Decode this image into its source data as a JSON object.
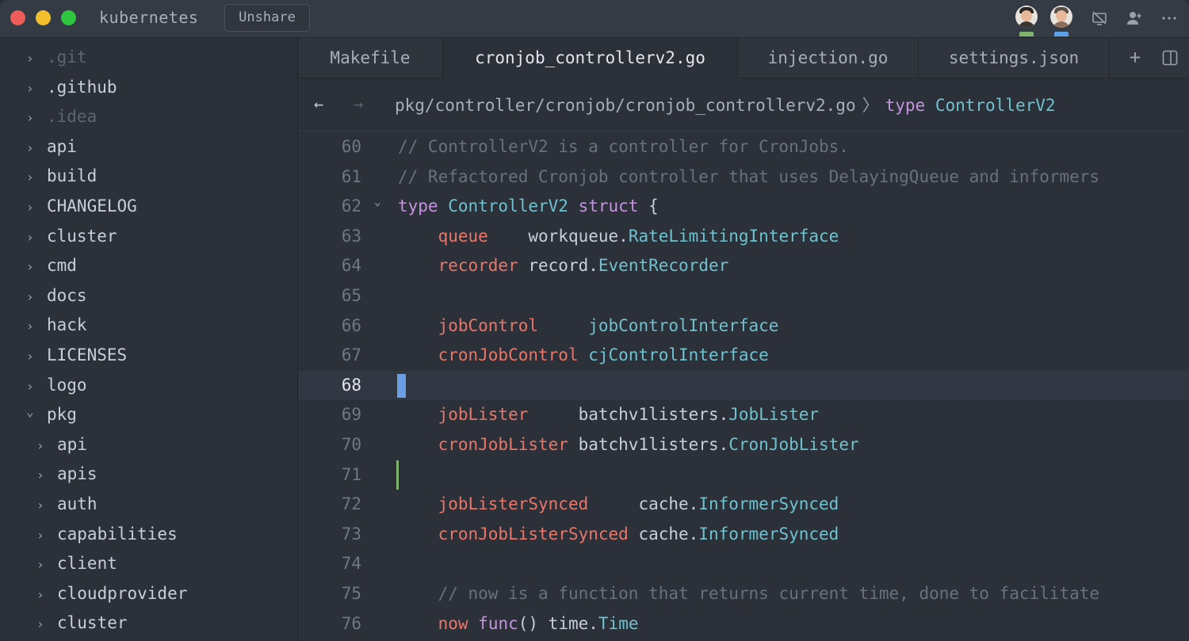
{
  "titlebar": {
    "project": "kubernetes",
    "unshare_label": "Unshare"
  },
  "sidebar": {
    "items": [
      {
        "label": ".git",
        "dim": true,
        "expanded": false
      },
      {
        "label": ".github",
        "dim": false,
        "expanded": false
      },
      {
        "label": ".idea",
        "dim": true,
        "expanded": false
      },
      {
        "label": "api",
        "dim": false,
        "expanded": false
      },
      {
        "label": "build",
        "dim": false,
        "expanded": false
      },
      {
        "label": "CHANGELOG",
        "dim": false,
        "expanded": false
      },
      {
        "label": "cluster",
        "dim": false,
        "expanded": false
      },
      {
        "label": "cmd",
        "dim": false,
        "expanded": false
      },
      {
        "label": "docs",
        "dim": false,
        "expanded": false
      },
      {
        "label": "hack",
        "dim": false,
        "expanded": false
      },
      {
        "label": "LICENSES",
        "dim": false,
        "expanded": false
      },
      {
        "label": "logo",
        "dim": false,
        "expanded": false
      },
      {
        "label": "pkg",
        "dim": false,
        "expanded": true
      },
      {
        "label": "api",
        "dim": false,
        "expanded": false,
        "child": true
      },
      {
        "label": "apis",
        "dim": false,
        "expanded": false,
        "child": true
      },
      {
        "label": "auth",
        "dim": false,
        "expanded": false,
        "child": true
      },
      {
        "label": "capabilities",
        "dim": false,
        "expanded": false,
        "child": true
      },
      {
        "label": "client",
        "dim": false,
        "expanded": false,
        "child": true
      },
      {
        "label": "cloudprovider",
        "dim": false,
        "expanded": false,
        "child": true
      },
      {
        "label": "cluster",
        "dim": false,
        "expanded": false,
        "child": true
      }
    ]
  },
  "tabs": [
    {
      "label": "Makefile",
      "active": false
    },
    {
      "label": "cronjob_controllerv2.go",
      "active": true
    },
    {
      "label": "injection.go",
      "active": false
    },
    {
      "label": "settings.json",
      "active": false
    }
  ],
  "breadcrumb": {
    "path": "pkg/controller/cronjob/cronjob_controllerv2.go",
    "separator": "〉",
    "symbol_kind": "type",
    "symbol_name": "ControllerV2"
  },
  "editor": {
    "current_line": 68,
    "lines": [
      {
        "n": "60",
        "tokens": [
          {
            "t": "// ControllerV2 is a controller for CronJobs.",
            "c": "comment"
          }
        ]
      },
      {
        "n": "61",
        "tokens": [
          {
            "t": "// Refactored Cronjob controller that uses DelayingQueue and informers",
            "c": "comment"
          }
        ]
      },
      {
        "n": "62",
        "fold": true,
        "tokens": [
          {
            "t": "type ",
            "c": "kw"
          },
          {
            "t": "ControllerV2 ",
            "c": "type"
          },
          {
            "t": "struct",
            "c": "kw"
          },
          {
            "t": " {",
            "c": "plain"
          }
        ]
      },
      {
        "n": "63",
        "tokens": [
          {
            "t": "    ",
            "c": "plain"
          },
          {
            "t": "queue",
            "c": "field"
          },
          {
            "t": "    workqueue.",
            "c": "plain"
          },
          {
            "t": "RateLimitingInterface",
            "c": "type"
          }
        ]
      },
      {
        "n": "64",
        "tokens": [
          {
            "t": "    ",
            "c": "plain"
          },
          {
            "t": "recorder",
            "c": "field"
          },
          {
            "t": " record.",
            "c": "plain"
          },
          {
            "t": "EventRecorder",
            "c": "type"
          }
        ]
      },
      {
        "n": "65",
        "tokens": []
      },
      {
        "n": "66",
        "tokens": [
          {
            "t": "    ",
            "c": "plain"
          },
          {
            "t": "jobControl",
            "c": "field"
          },
          {
            "t": "     ",
            "c": "plain"
          },
          {
            "t": "jobControlInterface",
            "c": "type"
          }
        ]
      },
      {
        "n": "67",
        "tokens": [
          {
            "t": "    ",
            "c": "plain"
          },
          {
            "t": "cronJobControl",
            "c": "field"
          },
          {
            "t": " ",
            "c": "plain"
          },
          {
            "t": "cjControlInterface",
            "c": "type"
          }
        ]
      },
      {
        "n": "68",
        "current": true,
        "tokens": []
      },
      {
        "n": "69",
        "tokens": [
          {
            "t": "    ",
            "c": "plain"
          },
          {
            "t": "jobLister",
            "c": "field"
          },
          {
            "t": "     batchv1listers.",
            "c": "plain"
          },
          {
            "t": "JobLister",
            "c": "type"
          }
        ]
      },
      {
        "n": "70",
        "tokens": [
          {
            "t": "    ",
            "c": "plain"
          },
          {
            "t": "cronJobLister",
            "c": "field"
          },
          {
            "t": " batchv1listers.",
            "c": "plain"
          },
          {
            "t": "CronJobLister",
            "c": "type"
          }
        ]
      },
      {
        "n": "71",
        "gitmark": true,
        "tokens": []
      },
      {
        "n": "72",
        "tokens": [
          {
            "t": "    ",
            "c": "plain"
          },
          {
            "t": "jobListerSynced",
            "c": "field"
          },
          {
            "t": "     cache.",
            "c": "plain"
          },
          {
            "t": "InformerSynced",
            "c": "type"
          }
        ]
      },
      {
        "n": "73",
        "tokens": [
          {
            "t": "    ",
            "c": "plain"
          },
          {
            "t": "cronJobListerSynced",
            "c": "field"
          },
          {
            "t": " cache.",
            "c": "plain"
          },
          {
            "t": "InformerSynced",
            "c": "type"
          }
        ]
      },
      {
        "n": "74",
        "tokens": []
      },
      {
        "n": "75",
        "tokens": [
          {
            "t": "    ",
            "c": "plain"
          },
          {
            "t": "// now is a function that returns current time, done to facilitate",
            "c": "comment"
          }
        ]
      },
      {
        "n": "76",
        "tokens": [
          {
            "t": "    ",
            "c": "plain"
          },
          {
            "t": "now",
            "c": "field"
          },
          {
            "t": " ",
            "c": "plain"
          },
          {
            "t": "func",
            "c": "kw"
          },
          {
            "t": "() time.",
            "c": "plain"
          },
          {
            "t": "Time",
            "c": "type"
          }
        ]
      }
    ]
  },
  "colors": {
    "comment": "#6a717e",
    "keyword": "#c594e0",
    "type": "#6fc2cf",
    "field": "#e8776a",
    "cursor": "#6a9fe3",
    "git_added": "#7fb26a"
  }
}
